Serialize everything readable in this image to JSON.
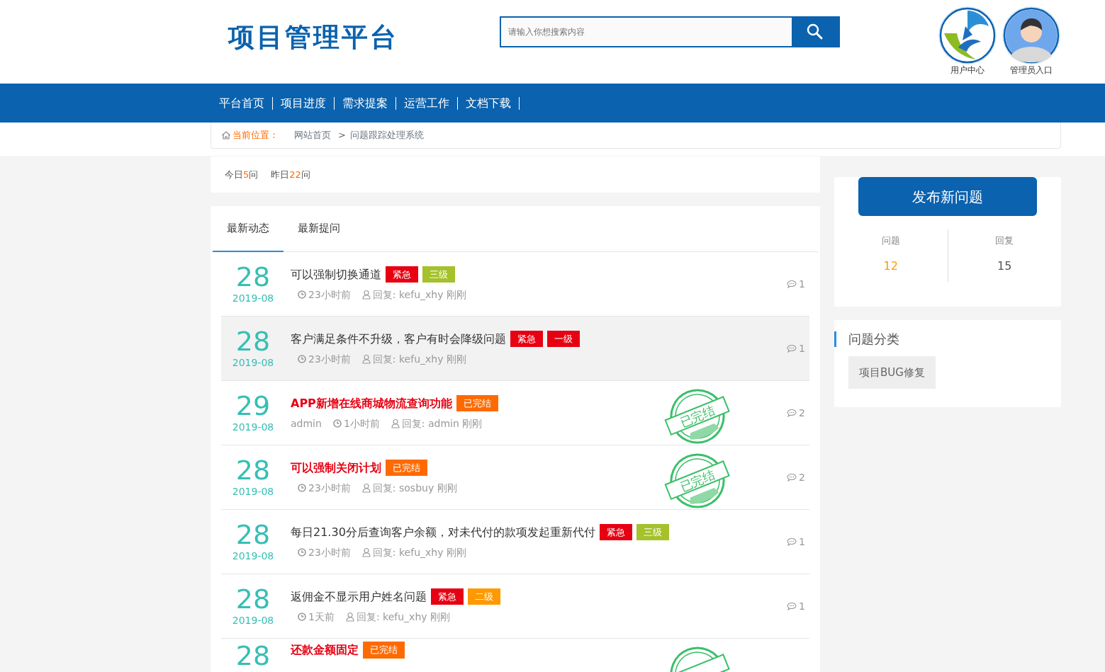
{
  "header": {
    "logo": "项目管理平台",
    "search": {
      "placeholder": "请输入你想搜索内容"
    },
    "portals": [
      {
        "label": "用户中心",
        "kind": "logo"
      },
      {
        "label": "管理员入口",
        "kind": "person"
      }
    ]
  },
  "nav": [
    "平台首页",
    "项目进度",
    "需求提案",
    "运营工作",
    "文档下载"
  ],
  "breadcrumb": {
    "label": "当前位置：",
    "items": [
      "网站首页",
      "问题跟踪处理系统"
    ],
    "separator": ">"
  },
  "stats": [
    {
      "prefix": "今日",
      "count": "5",
      "suffix": "问"
    },
    {
      "prefix": "昨日",
      "count": "22",
      "suffix": "问"
    }
  ],
  "tabs": [
    {
      "label": "最新动态",
      "selected": true
    },
    {
      "label": "最新提问",
      "selected": false
    }
  ],
  "posts": [
    {
      "day": "28",
      "month": "2019-08",
      "title": "可以强制切换通道",
      "resolved": false,
      "highlighted": false,
      "tags": [
        {
          "text": "紧急",
          "color": "#e60012"
        },
        {
          "text": "三级",
          "color": "#a5c12b"
        }
      ],
      "time": "23小时前",
      "reply": "回复: kefu_xhy 刚刚",
      "comments": "1"
    },
    {
      "day": "28",
      "month": "2019-08",
      "title": "客户满足条件不升级，客户有时会降级问题",
      "resolved": false,
      "highlighted": true,
      "tags": [
        {
          "text": "紧急",
          "color": "#e60012"
        },
        {
          "text": "一级",
          "color": "#e60012"
        }
      ],
      "time": "23小时前",
      "reply": "回复: kefu_xhy 刚刚",
      "comments": "1"
    },
    {
      "day": "29",
      "month": "2019-08",
      "title": "APP新增在线商城物流查询功能",
      "resolved": true,
      "stamp": "已完结",
      "highlighted": false,
      "tags": [
        {
          "text": "已完结",
          "color": "#ff6a00"
        }
      ],
      "author": "admin",
      "time": "1小时前",
      "reply": "回复: admin 刚刚",
      "comments": "2"
    },
    {
      "day": "28",
      "month": "2019-08",
      "title": "可以强制关闭计划",
      "resolved": true,
      "stamp": "已完结",
      "highlighted": false,
      "tags": [
        {
          "text": "已完结",
          "color": "#ff6a00"
        }
      ],
      "time": "23小时前",
      "reply": "回复: sosbuy 刚刚",
      "comments": "2"
    },
    {
      "day": "28",
      "month": "2019-08",
      "title": "每日21.30分后查询客户余额，对未代付的款项发起重新代付",
      "resolved": false,
      "highlighted": false,
      "tags": [
        {
          "text": "紧急",
          "color": "#e60012"
        },
        {
          "text": "三级",
          "color": "#a5c12b"
        }
      ],
      "time": "23小时前",
      "reply": "回复: kefu_xhy 刚刚",
      "comments": "1"
    },
    {
      "day": "28",
      "month": "2019-08",
      "title": "返佣金不显示用户姓名问题",
      "resolved": false,
      "highlighted": false,
      "tags": [
        {
          "text": "紧急",
          "color": "#e60012"
        },
        {
          "text": "二级",
          "color": "#ff9900"
        }
      ],
      "time": "1天前",
      "reply": "回复: kefu_xhy 刚刚",
      "comments": "1"
    },
    {
      "day": "28",
      "title": "还款金额固定",
      "resolved": true,
      "highlighted": false,
      "tags": [
        {
          "text": "已完结",
          "color": "#ff6a00"
        }
      ]
    }
  ],
  "sidebar": {
    "post_button": "发布新问题",
    "counts": [
      {
        "label": "问题",
        "value": "12",
        "kind": "accent"
      },
      {
        "label": "回复",
        "value": "15",
        "kind": "plain"
      }
    ],
    "category_title": "问题分类",
    "categories": [
      "项目BUG修复"
    ]
  }
}
